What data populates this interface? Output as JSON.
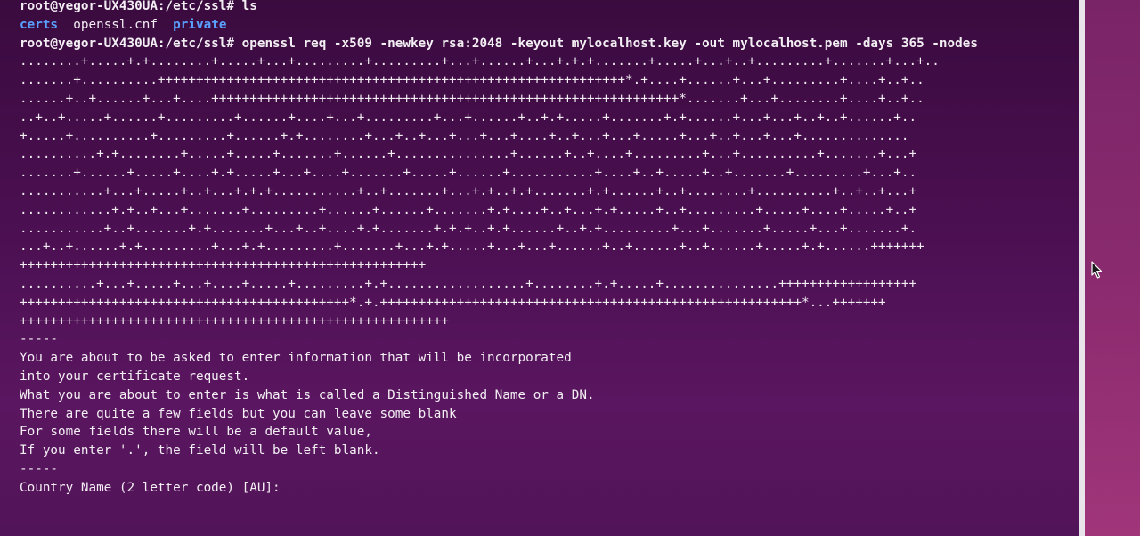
{
  "terminal": {
    "lines": [
      {
        "segments": [
          {
            "text": "root@yegor-UX430UA:/etc/ssl# ls",
            "kind": "prompt"
          }
        ]
      },
      {
        "segments": [
          {
            "text": "certs",
            "kind": "dir"
          },
          {
            "text": "  openssl.cnf  ",
            "kind": "plain"
          },
          {
            "text": "private",
            "kind": "dir"
          }
        ]
      },
      {
        "segments": [
          {
            "text": "root@yegor-UX430UA:/etc/ssl# openssl req -x509 -newkey rsa:2048 -keyout mylocalhost.key -out mylocalhost.pem -days 365 -nodes",
            "kind": "prompt"
          }
        ]
      },
      {
        "segments": [
          {
            "text": "........+.....+.+........+.....+...+.........+.........+...+......+...+.+.+.......+.....+...+..+.........+.......+...+..",
            "kind": "plain"
          }
        ]
      },
      {
        "segments": [
          {
            "text": ".......+..........+++++++++++++++++++++++++++++++++++++++++++++++++++++++++++++*.+....+......+...+.........+....+..+..",
            "kind": "plain"
          }
        ]
      },
      {
        "segments": [
          {
            "text": "......+..+......+...+....+++++++++++++++++++++++++++++++++++++++++++++++++++++++++++++*.......+...+........+....+..+..",
            "kind": "plain"
          }
        ]
      },
      {
        "segments": [
          {
            "text": "..+..+.....+......+.........+......+....+...+.........+...+......+..+.+.....+.......+.+......+...+...+..+..+......+..",
            "kind": "plain"
          }
        ]
      },
      {
        "segments": [
          {
            "text": "+.....+..........+.........+......+.+........+...+..+...+...+...+....+..+...+...+.....+...+..+...+...+..............",
            "kind": "plain"
          }
        ]
      },
      {
        "segments": [
          {
            "text": "..........+.+........+.....+.....+.......+......+...............+......+..+....+.........+...+..........+.......+...+",
            "kind": "plain"
          }
        ]
      },
      {
        "segments": [
          {
            "text": ".......+......+.....+....+.+.....+...+....+.......+.....+......+...........+....+..+.....+..+.......+.........+...+..",
            "kind": "plain"
          }
        ]
      },
      {
        "segments": [
          {
            "text": "...........+...+.....+..+...+.+.+...........+..+.......+...+.+..+.+.......+.+......+..+........+..........+..+..+...+",
            "kind": "plain"
          }
        ]
      },
      {
        "segments": [
          {
            "text": "............+.+..+...+.......+.........+......+......+.......+.+....+..+...+.+.....+..+.........+.....+....+.....+..+",
            "kind": "plain"
          }
        ]
      },
      {
        "segments": [
          {
            "text": "...........+..+.......+.+.......+...+..+....+.+.......+.+.+..+.+......+..+.+.........+...+.......+.....+...+.......+.",
            "kind": "plain"
          }
        ]
      },
      {
        "segments": [
          {
            "text": "...+..+......+.+.........+...+.+.........+.......+...+.+.....+...+...+......+..+......+..+......+.....+.+......+++++++",
            "kind": "plain"
          }
        ]
      },
      {
        "segments": [
          {
            "text": "+++++++++++++++++++++++++++++++++++++++++++++++++++++",
            "kind": "plain"
          }
        ]
      },
      {
        "segments": [
          {
            "text": "..........+...+.....+...+....+.....+.........+.+..................+........+.+.....+...............++++++++++++++++++",
            "kind": "plain"
          }
        ]
      },
      {
        "segments": [
          {
            "text": "+++++++++++++++++++++++++++++++++++++++++++*.+.+++++++++++++++++++++++++++++++++++++++++++++++++++++++*...+++++++",
            "kind": "plain"
          }
        ]
      },
      {
        "segments": [
          {
            "text": "++++++++++++++++++++++++++++++++++++++++++++++++++++++++",
            "kind": "plain"
          }
        ]
      },
      {
        "segments": [
          {
            "text": "-----",
            "kind": "plain"
          }
        ]
      },
      {
        "segments": [
          {
            "text": "You are about to be asked to enter information that will be incorporated",
            "kind": "plain"
          }
        ]
      },
      {
        "segments": [
          {
            "text": "into your certificate request.",
            "kind": "plain"
          }
        ]
      },
      {
        "segments": [
          {
            "text": "What you are about to enter is what is called a Distinguished Name or a DN.",
            "kind": "plain"
          }
        ]
      },
      {
        "segments": [
          {
            "text": "There are quite a few fields but you can leave some blank",
            "kind": "plain"
          }
        ]
      },
      {
        "segments": [
          {
            "text": "For some fields there will be a default value,",
            "kind": "plain"
          }
        ]
      },
      {
        "segments": [
          {
            "text": "If you enter '.', the field will be left blank.",
            "kind": "plain"
          }
        ]
      },
      {
        "segments": [
          {
            "text": "-----",
            "kind": "plain"
          }
        ]
      },
      {
        "segments": [
          {
            "text": "Country Name (2 letter code) [AU]:",
            "kind": "plain"
          }
        ]
      }
    ]
  },
  "colors": {
    "directory": "#5aa0ff",
    "text": "#f3eef3",
    "background": "#4a0f50"
  },
  "cursor_icon": "mouse-pointer-arrow"
}
